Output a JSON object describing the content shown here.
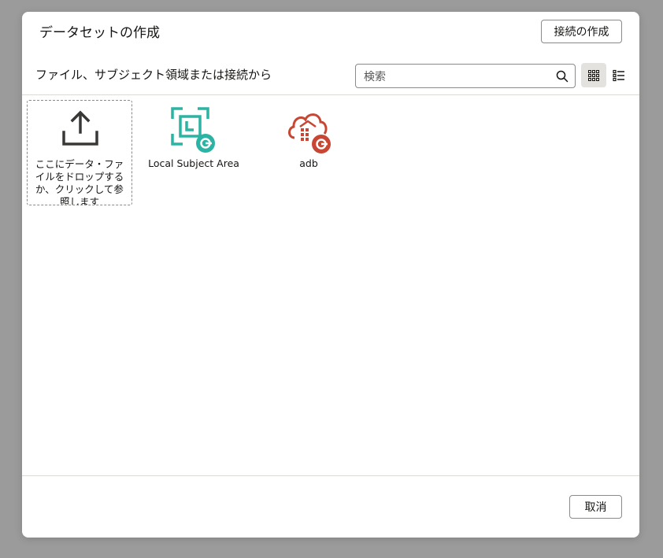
{
  "dialog": {
    "title": "データセットの作成",
    "create_connection_button": "接続の作成",
    "subtitle": "ファイル、サブジェクト領域または接続から",
    "search": {
      "placeholder": "検索",
      "icon": "search-icon"
    },
    "view_toggle": {
      "grid_icon": "grid-view-icon",
      "list_icon": "list-view-icon",
      "selected": "grid"
    },
    "dropzone": {
      "icon": "upload-icon",
      "text": "ここにデータ・ファイルをドロップするか、クリックして参照します"
    },
    "sources": [
      {
        "label": "Local Subject Area",
        "icon": "subject-area-icon",
        "color": "#2bb3a4"
      },
      {
        "label": "adb",
        "icon": "cloud-database-icon",
        "color": "#c74634"
      }
    ],
    "cancel_button": "取消"
  }
}
